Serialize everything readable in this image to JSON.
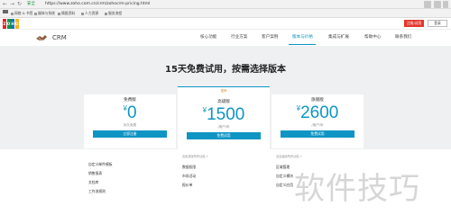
{
  "browser": {
    "secure_label": "安全",
    "url": "https://www.zoho.com.cn/crm/zohocrm-pricing.html",
    "bookmarks": [
      "网络 & 书签",
      "媒体与系统",
      "情报资料",
      "人力资源",
      "服务流程"
    ]
  },
  "zoho_bar": {
    "logo_letters": [
      "Z",
      "O",
      "H",
      "O"
    ],
    "logo_colors": [
      "#e42527",
      "#089949",
      "#226db4",
      "#f9b21d"
    ],
    "signup_label": "注册/试用",
    "login_label": "登录"
  },
  "crm_header": {
    "brand": "CRM",
    "nav": [
      {
        "label": "核心功能"
      },
      {
        "label": "行业方案"
      },
      {
        "label": "客户案例"
      },
      {
        "label": "版本与价格",
        "active": true
      },
      {
        "label": "集成与扩展"
      },
      {
        "label": "帮助中心"
      },
      {
        "label": "联系我们"
      }
    ]
  },
  "hero": {
    "title": "15天免费试用，按需选择版本"
  },
  "plans": [
    {
      "name": "免费版",
      "currency": "¥",
      "price": "0",
      "note": "永久免费",
      "cta": "立即注册"
    },
    {
      "badge": "推荐",
      "name": "高级版",
      "currency": "¥",
      "price": "1500",
      "note": "/用户/年",
      "cta": "免费试用"
    },
    {
      "name": "旗舰版",
      "currency": "¥",
      "price": "2600",
      "note": "/用户/年",
      "cta": "免费试用"
    }
  ],
  "features": [
    {
      "items": [
        "自定义邮件模板",
        "销售报表",
        "文档库",
        "工作流规则"
      ]
    },
    {
      "caption": "含免费版所有功能 +",
      "items": [
        "数据权限",
        "市场活动",
        "报价单"
      ]
    },
    {
      "caption": "含高级版所有功能 +",
      "items": [
        "区域管理",
        "自定义模块",
        "自定义应用"
      ]
    }
  ],
  "watermark": "软件技巧"
}
